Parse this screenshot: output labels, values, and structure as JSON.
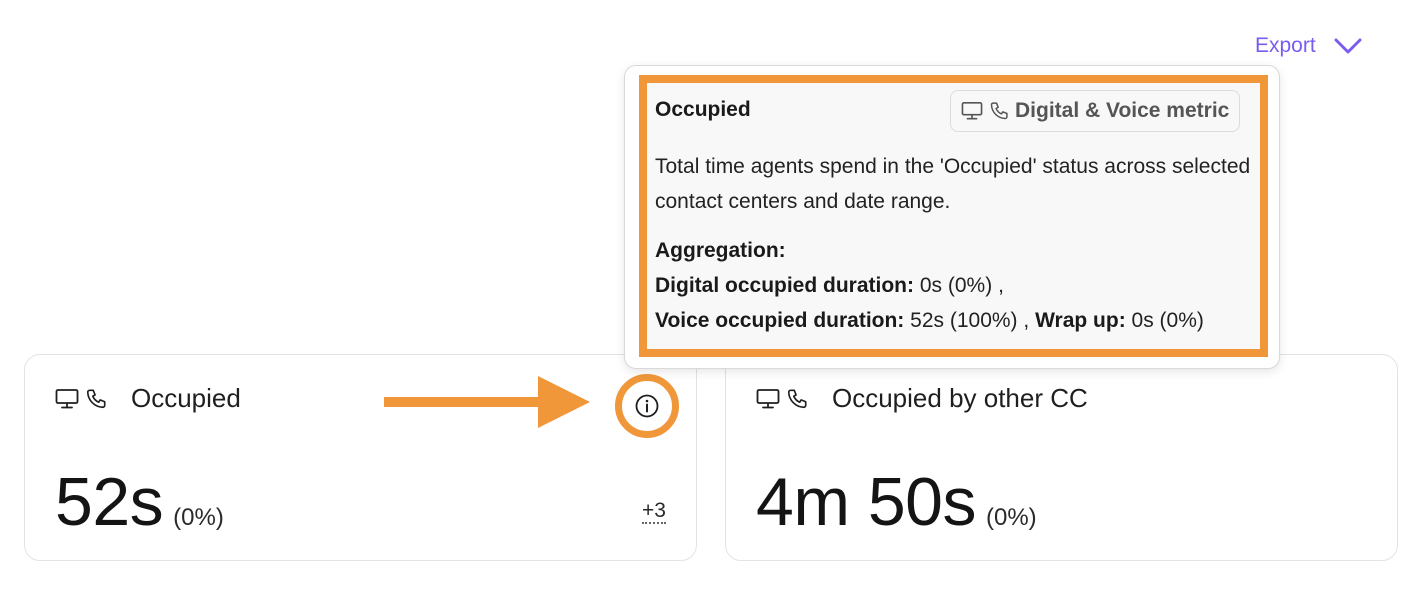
{
  "header": {
    "export_label": "Export"
  },
  "tooltip": {
    "title": "Occupied",
    "metric_chip": "Digital & Voice metric",
    "description": "Total time agents spend in the 'Occupied' status across selected contact centers and date range.",
    "aggregation_label": "Aggregation:",
    "digital_label": "Digital occupied duration:",
    "digital_value": "0s (0%)",
    "sep1": ",",
    "voice_label": "Voice occupied duration:",
    "voice_value": "52s (100%)",
    "sep2": ",",
    "wrap_label": "Wrap up:",
    "wrap_value": "0s (0%)"
  },
  "cards": [
    {
      "title": "Occupied",
      "value": "52s",
      "percent": "(0%)",
      "extra": "+3"
    },
    {
      "title": "Occupied by other CC",
      "value": "4m 50s",
      "percent": "(0%)"
    }
  ],
  "colors": {
    "accent": "#7b5cf0",
    "annotation": "#f0973a"
  },
  "icons": [
    "monitor-icon",
    "phone-icon",
    "info-icon",
    "chevron-down-icon",
    "arrow-right-icon"
  ]
}
